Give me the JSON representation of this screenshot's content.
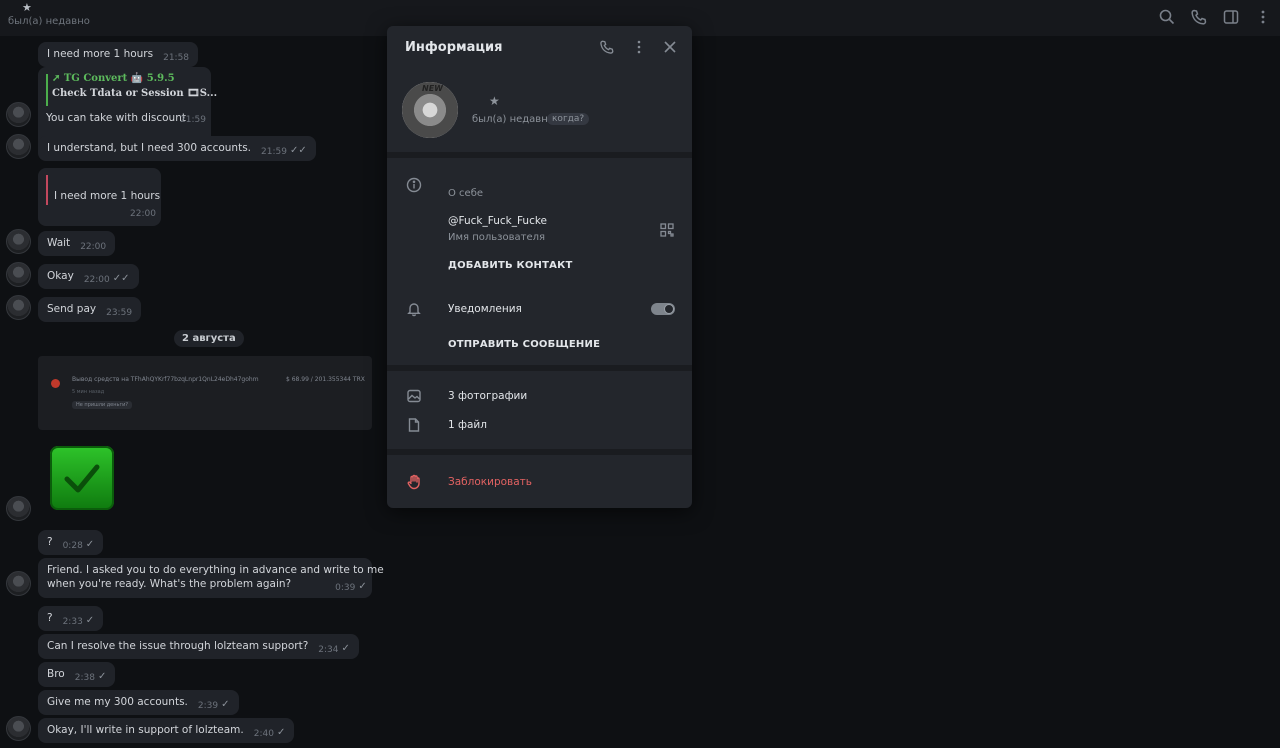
{
  "header": {
    "star": "★",
    "status": "был(а) недавно",
    "icons": [
      "search-icon",
      "phone-icon",
      "sidebar-panel-icon",
      "more-vertical-icon"
    ]
  },
  "chat": {
    "m1": {
      "text": "I need more 1 hours",
      "time": "21:58"
    },
    "fwd": {
      "line1": "➚ TG Convert 🤖 5.9.5",
      "line2": "Check Tdata or Session 🎞S...",
      "text": "You can take with discount",
      "time": "21:59"
    },
    "m2": {
      "text": "I understand, but I need 300 accounts.",
      "time": "21:59"
    },
    "reply": {
      "text": "I need more 1 hours",
      "time": "22:00"
    },
    "m3": {
      "text": "Wait",
      "time": "22:00"
    },
    "m4": {
      "text": "Okay",
      "time": "22:00"
    },
    "m5": {
      "text": "Send pay",
      "time": "23:59"
    },
    "date": "2 августа",
    "shot": {
      "line1": "Вывод средств на TFhAhQYKrf77bzqLnpr1QnL24eDh47gohm",
      "amount": "$ 68.99 / 201.355344 TRX",
      "line2": "5 мин назад",
      "pill": "Не пришли деньги?"
    },
    "m6": {
      "text": "?",
      "time": "0:28"
    },
    "m7": {
      "text1": "Friend. I asked you to do everything in advance and write to me",
      "text2": "when you're ready. What's the problem again?",
      "time": "0:39"
    },
    "m8": {
      "text": "?",
      "time": "2:33"
    },
    "m9": {
      "text": "Can I resolve the issue through lolzteam support?",
      "time": "2:34"
    },
    "m10": {
      "text": "Bro",
      "time": "2:38"
    },
    "m11": {
      "text": "Give me my 300 accounts.",
      "time": "2:39"
    },
    "m12": {
      "text": "Okay, I'll write in support of lolzteam.",
      "time": "2:40"
    },
    "tick": "✓",
    "dtick": "✓✓"
  },
  "panel": {
    "title": "Информация",
    "avatar_tag": "NEW",
    "star": "★",
    "status": "был(а) недавно",
    "when": "когда?",
    "about": "О себе",
    "username": "@Fuck_Fuck_Fucke",
    "username_label": "Имя пользователя",
    "add_contact": "ДОБАВИТЬ КОНТАКТ",
    "notifications": "Уведомления",
    "notifications_on": true,
    "send_message": "ОТПРАВИТЬ СООБЩЕНИЕ",
    "photos": "3 фотографии",
    "files": "1 файл",
    "block": "Заблокировать",
    "colors": {
      "danger": "#e26262",
      "panel_bg": "#23262c"
    }
  }
}
